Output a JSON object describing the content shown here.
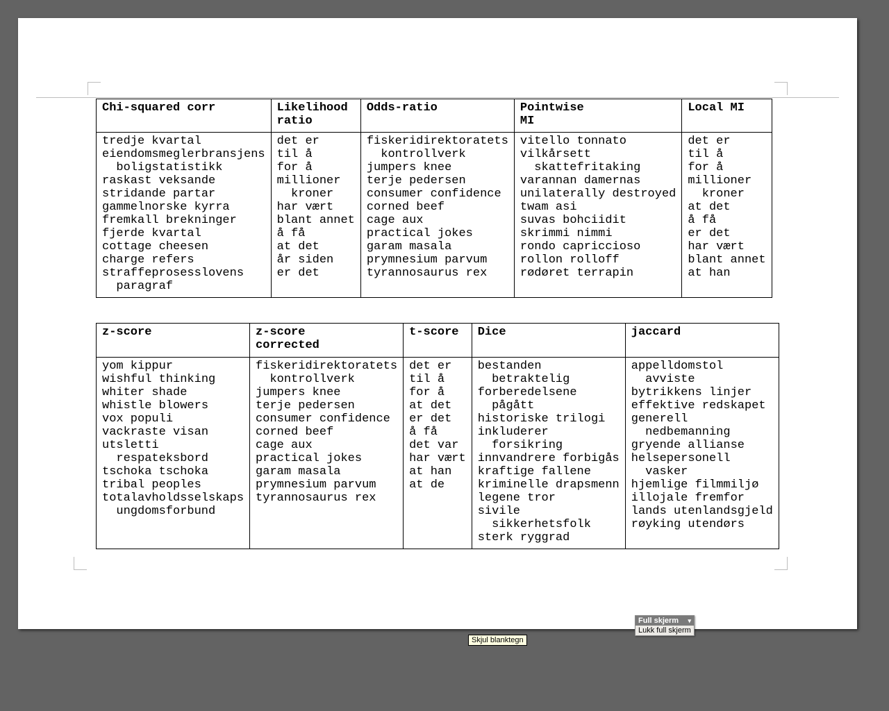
{
  "table1": {
    "headers": [
      "Chi-squared corr",
      "Likelihood ratio",
      "Odds-ratio",
      "Pointwise MI",
      "Local MI"
    ],
    "cols": [
      [
        {
          "t": "tredje kvartal"
        },
        {
          "t": "eiendomsmeglerbransjens",
          "c": "boligstatistikk"
        },
        {
          "t": "raskast veksande"
        },
        {
          "t": "stridande partar"
        },
        {
          "t": "gammelnorske kyrra"
        },
        {
          "t": "fremkall brekninger"
        },
        {
          "t": "fjerde kvartal"
        },
        {
          "t": "cottage cheesen"
        },
        {
          "t": "charge refers"
        },
        {
          "t": "straffeprosesslovens",
          "c": "paragraf"
        }
      ],
      [
        {
          "t": "det er"
        },
        {
          "t": "til å"
        },
        {
          "t": "for å"
        },
        {
          "t": "millioner",
          "c": "kroner"
        },
        {
          "t": "har vært"
        },
        {
          "t": "blant annet"
        },
        {
          "t": "å få"
        },
        {
          "t": "at det"
        },
        {
          "t": "år siden"
        },
        {
          "t": "er det"
        }
      ],
      [
        {
          "t": "fiskeridirektoratets",
          "c": "kontrollverk"
        },
        {
          "t": "jumpers knee"
        },
        {
          "t": "terje pedersen"
        },
        {
          "t": "consumer confidence"
        },
        {
          "t": "corned beef"
        },
        {
          "t": "cage aux"
        },
        {
          "t": "practical jokes"
        },
        {
          "t": "garam masala"
        },
        {
          "t": "prymnesium parvum"
        },
        {
          "t": "tyrannosaurus rex"
        }
      ],
      [
        {
          "t": "vitello tonnato"
        },
        {
          "t": "vilkårsett",
          "c": "skattefritaking"
        },
        {
          "t": "varannan damernas"
        },
        {
          "t": "unilaterally destroyed"
        },
        {
          "t": "twam asi"
        },
        {
          "t": "suvas bohciidit"
        },
        {
          "t": "skrimmi nimmi"
        },
        {
          "t": "rondo capriccioso"
        },
        {
          "t": "rollon rolloff"
        },
        {
          "t": "rødøret terrapin"
        }
      ],
      [
        {
          "t": "det er"
        },
        {
          "t": "til å"
        },
        {
          "t": "for å"
        },
        {
          "t": "millioner",
          "c": "kroner"
        },
        {
          "t": "at det"
        },
        {
          "t": "å få"
        },
        {
          "t": "er det"
        },
        {
          "t": "har vært"
        },
        {
          "t": "blant annet"
        },
        {
          "t": "at han"
        }
      ]
    ]
  },
  "table2": {
    "headers": [
      "z-score",
      "z-score corrected",
      "t-score",
      "Dice",
      "jaccard"
    ],
    "cols": [
      [
        {
          "t": "yom kippur"
        },
        {
          "t": "wishful thinking"
        },
        {
          "t": "whiter shade"
        },
        {
          "t": "whistle blowers"
        },
        {
          "t": "vox populi"
        },
        {
          "t": "vackraste visan"
        },
        {
          "t": "utsletti",
          "c": "respateksbord"
        },
        {
          "t": "tschoka tschoka"
        },
        {
          "t": "tribal peoples"
        },
        {
          "t": "totalavholdsselskaps",
          "c": "ungdomsforbund"
        }
      ],
      [
        {
          "t": "fiskeridirektoratets",
          "c": "kontrollverk"
        },
        {
          "t": "jumpers knee"
        },
        {
          "t": "terje pedersen"
        },
        {
          "t": "consumer confidence"
        },
        {
          "t": "corned beef"
        },
        {
          "t": "cage aux"
        },
        {
          "t": "practical jokes"
        },
        {
          "t": "garam masala"
        },
        {
          "t": "prymnesium parvum"
        },
        {
          "t": "tyrannosaurus rex"
        }
      ],
      [
        {
          "t": "det er"
        },
        {
          "t": "til å"
        },
        {
          "t": "for å"
        },
        {
          "t": "at det"
        },
        {
          "t": "er det"
        },
        {
          "t": "å få"
        },
        {
          "t": "det var"
        },
        {
          "t": "har vært"
        },
        {
          "t": "at han"
        },
        {
          "t": "at de"
        }
      ],
      [
        {
          "t": "bestanden",
          "c": "betraktelig"
        },
        {
          "t": "forberedelsene",
          "c": "pågått"
        },
        {
          "t": "historiske trilogi"
        },
        {
          "t": "inkluderer",
          "c": "forsikring"
        },
        {
          "t": "innvandrere forbigås"
        },
        {
          "t": "kraftige fallene"
        },
        {
          "t": "kriminelle drapsmenn"
        },
        {
          "t": "legene tror"
        },
        {
          "t": "sivile",
          "c": "sikkerhetsfolk"
        },
        {
          "t": "sterk ryggrad"
        }
      ],
      [
        {
          "t": "appelldomstol",
          "c": "avviste"
        },
        {
          "t": "bytrikkens linjer"
        },
        {
          "t": "effektive redskapet"
        },
        {
          "t": "generell",
          "c": "nedbemanning"
        },
        {
          "t": "gryende allianse"
        },
        {
          "t": "helsepersonell",
          "c": "vasker"
        },
        {
          "t": "hjemlige filmmiljø"
        },
        {
          "t": "illojale fremfor"
        },
        {
          "t": "lands utenlandsgjeld"
        },
        {
          "t": "røyking utendørs"
        }
      ]
    ]
  },
  "fullscreen": {
    "title": "Full skjerm",
    "close": "Lukk full skjerm"
  },
  "tooltip": "Skjul blanktegn"
}
